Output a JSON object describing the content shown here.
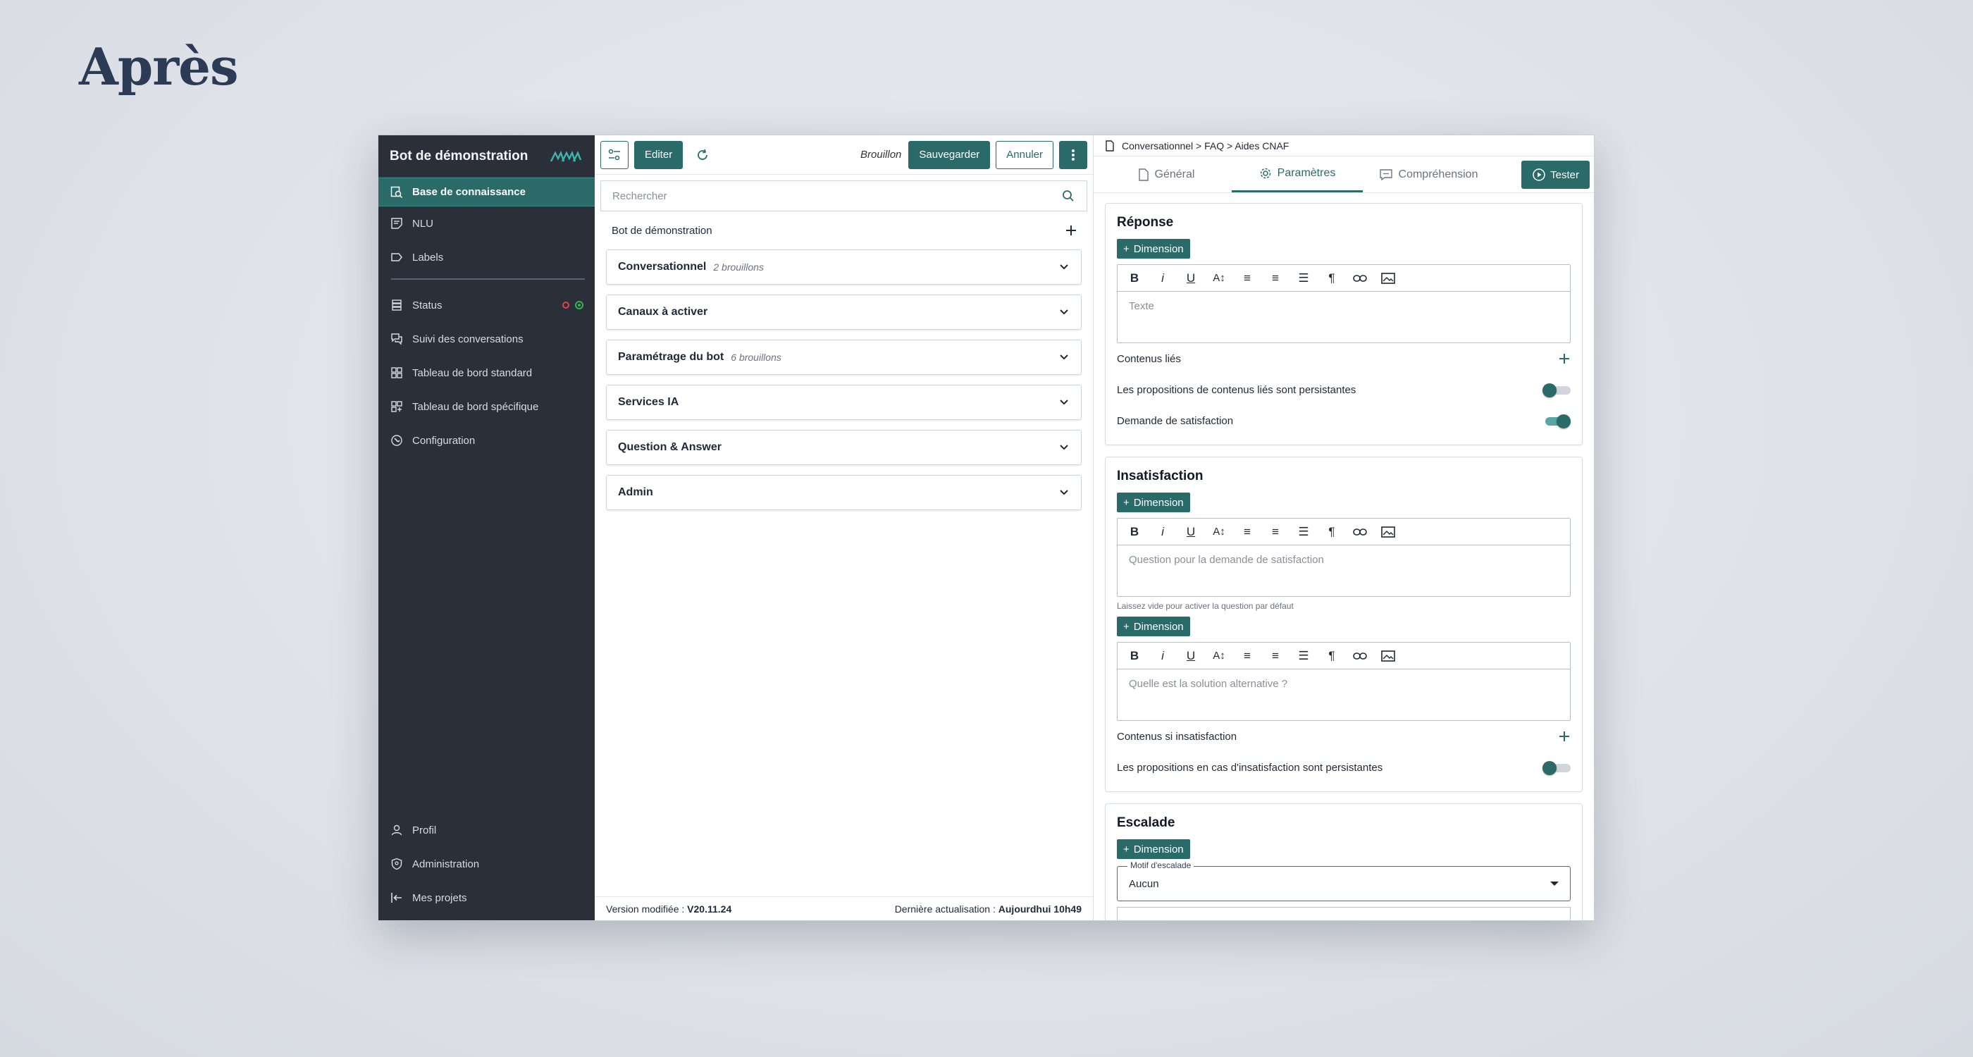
{
  "page_heading": "Après",
  "sidebar": {
    "title": "Bot de démonstration",
    "items": [
      {
        "label": "Base de connaissance",
        "icon": "knowledge-search-icon"
      },
      {
        "label": "NLU",
        "icon": "note-icon"
      },
      {
        "label": "Labels",
        "icon": "label-icon"
      },
      {
        "label": "Status",
        "icon": "server-icon"
      },
      {
        "label": "Suivi des conversations",
        "icon": "chat-icon"
      },
      {
        "label": "Tableau de bord standard",
        "icon": "dashboard-icon"
      },
      {
        "label": "Tableau de bord spécifique",
        "icon": "dashboard-add-icon"
      },
      {
        "label": "Configuration",
        "icon": "config-icon"
      }
    ],
    "bottom_items": [
      {
        "label": "Profil",
        "icon": "user-icon"
      },
      {
        "label": "Administration",
        "icon": "shield-icon"
      },
      {
        "label": "Mes projets",
        "icon": "exit-icon"
      }
    ]
  },
  "toolbar": {
    "edit_label": "Editer",
    "draft_label": "Brouillon",
    "save_label": "Sauvegarder",
    "cancel_label": "Annuler"
  },
  "search": {
    "placeholder": "Rechercher"
  },
  "tree": {
    "root_label": "Bot de démonstration",
    "groups": [
      {
        "title": "Conversationnel",
        "sub": "2 brouillons"
      },
      {
        "title": "Canaux à activer",
        "sub": ""
      },
      {
        "title": "Paramétrage du bot",
        "sub": "6 brouillons"
      },
      {
        "title": "Services IA",
        "sub": ""
      },
      {
        "title": "Question & Answer",
        "sub": ""
      },
      {
        "title": "Admin",
        "sub": ""
      }
    ]
  },
  "footer": {
    "version_label": "Version modifiée : ",
    "version_value": "V20.11.24",
    "update_label": "Dernière actualisation : ",
    "update_value": "Aujourdhui 10h49"
  },
  "right": {
    "breadcrumb": "Conversationnel > FAQ > Aides CNAF",
    "tabs": [
      "Général",
      "Paramètres",
      "Compréhension"
    ],
    "tester_label": "Tester",
    "dimension_label": "Dimension",
    "reponse": {
      "title": "Réponse",
      "placeholder": "Texte",
      "linked_label": "Contenus liés",
      "persistent_label": "Les propositions de contenus liés sont persistantes",
      "persistent_on": false,
      "satisfaction_label": "Demande de satisfaction",
      "satisfaction_on": true
    },
    "insatisfaction": {
      "title": "Insatisfaction",
      "placeholder_question": "Question pour la demande de satisfaction",
      "hint": "Laissez vide pour activer la question par défaut",
      "placeholder_alt": "Quelle est la solution alternative ?",
      "contents_label": "Contenus si insatisfaction",
      "persistent_label": "Les propositions en cas d'insatisfaction sont persistantes",
      "persistent_on": false
    },
    "escalade": {
      "title": "Escalade",
      "motif_label": "Motif d'escalade",
      "motif_value": "Aucun"
    }
  },
  "colors": {
    "accent": "#2a6b6a",
    "sidebar_bg": "#2a2f3a"
  }
}
